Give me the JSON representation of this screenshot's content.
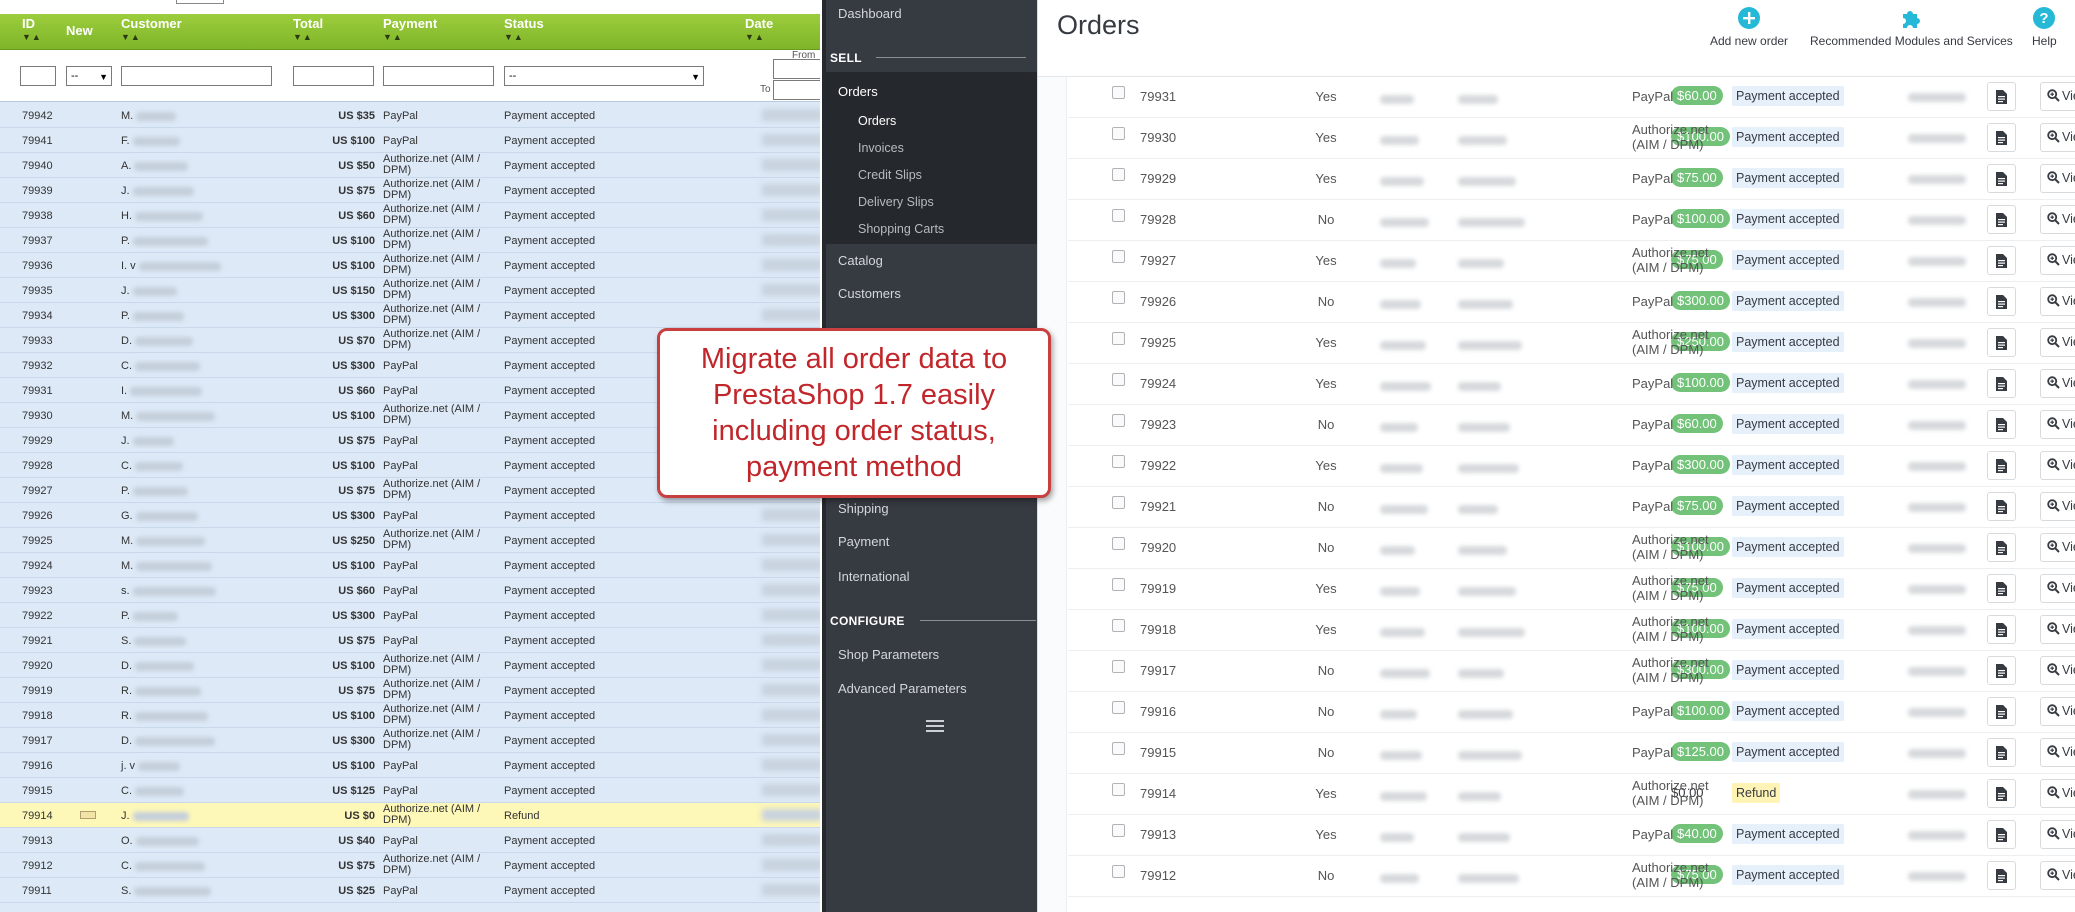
{
  "left": {
    "headers": {
      "id": "ID",
      "new": "New",
      "customer": "Customer",
      "total": "Total",
      "payment": "Payment",
      "status": "Status",
      "date": "Date"
    },
    "filters": {
      "new_value": "--",
      "status_value": "--",
      "from_label": "From",
      "to_label": "To"
    },
    "rows": [
      {
        "id": "79942",
        "initial": "M.",
        "total": "US $35",
        "payment": "PayPal",
        "status": "Payment accepted"
      },
      {
        "id": "79941",
        "initial": "F.",
        "total": "US $100",
        "payment": "PayPal",
        "status": "Payment accepted"
      },
      {
        "id": "79940",
        "initial": "A.",
        "total": "US $50",
        "payment": "Authorize.net (AIM / DPM)",
        "status": "Payment accepted"
      },
      {
        "id": "79939",
        "initial": "J.",
        "total": "US $75",
        "payment": "Authorize.net (AIM / DPM)",
        "status": "Payment accepted"
      },
      {
        "id": "79938",
        "initial": "H.",
        "total": "US $60",
        "payment": "Authorize.net (AIM / DPM)",
        "status": "Payment accepted"
      },
      {
        "id": "79937",
        "initial": "P.",
        "total": "US $100",
        "payment": "Authorize.net (AIM / DPM)",
        "status": "Payment accepted"
      },
      {
        "id": "79936",
        "initial": "I. v",
        "total": "US $100",
        "payment": "Authorize.net (AIM / DPM)",
        "status": "Payment accepted"
      },
      {
        "id": "79935",
        "initial": "J.",
        "total": "US $150",
        "payment": "Authorize.net (AIM / DPM)",
        "status": "Payment accepted"
      },
      {
        "id": "79934",
        "initial": "P.",
        "total": "US $300",
        "payment": "Authorize.net (AIM / DPM)",
        "status": "Payment accepted"
      },
      {
        "id": "79933",
        "initial": "D.",
        "total": "US $70",
        "payment": "Authorize.net (AIM / DPM)",
        "status": "Payment accepted"
      },
      {
        "id": "79932",
        "initial": "C.",
        "total": "US $300",
        "payment": "PayPal",
        "status": "Payment accepted"
      },
      {
        "id": "79931",
        "initial": "I.",
        "total": "US $60",
        "payment": "PayPal",
        "status": "Payment accepted"
      },
      {
        "id": "79930",
        "initial": "M.",
        "total": "US $100",
        "payment": "Authorize.net (AIM / DPM)",
        "status": "Payment accepted"
      },
      {
        "id": "79929",
        "initial": "J.",
        "total": "US $75",
        "payment": "PayPal",
        "status": "Payment accepted"
      },
      {
        "id": "79928",
        "initial": "C.",
        "total": "US $100",
        "payment": "PayPal",
        "status": "Payment accepted"
      },
      {
        "id": "79927",
        "initial": "P.",
        "total": "US $75",
        "payment": "Authorize.net (AIM / DPM)",
        "status": "Payment accepted"
      },
      {
        "id": "79926",
        "initial": "G.",
        "total": "US $300",
        "payment": "PayPal",
        "status": "Payment accepted"
      },
      {
        "id": "79925",
        "initial": "M.",
        "total": "US $250",
        "payment": "Authorize.net (AIM / DPM)",
        "status": "Payment accepted"
      },
      {
        "id": "79924",
        "initial": "M.",
        "total": "US $100",
        "payment": "PayPal",
        "status": "Payment accepted"
      },
      {
        "id": "79923",
        "initial": "s.",
        "total": "US $60",
        "payment": "PayPal",
        "status": "Payment accepted"
      },
      {
        "id": "79922",
        "initial": "P.",
        "total": "US $300",
        "payment": "PayPal",
        "status": "Payment accepted"
      },
      {
        "id": "79921",
        "initial": "S.",
        "total": "US $75",
        "payment": "PayPal",
        "status": "Payment accepted"
      },
      {
        "id": "79920",
        "initial": "D.",
        "total": "US $100",
        "payment": "Authorize.net (AIM / DPM)",
        "status": "Payment accepted"
      },
      {
        "id": "79919",
        "initial": "R.",
        "total": "US $75",
        "payment": "Authorize.net (AIM / DPM)",
        "status": "Payment accepted"
      },
      {
        "id": "79918",
        "initial": "R.",
        "total": "US $100",
        "payment": "Authorize.net (AIM / DPM)",
        "status": "Payment accepted"
      },
      {
        "id": "79917",
        "initial": "D.",
        "total": "US $300",
        "payment": "Authorize.net (AIM / DPM)",
        "status": "Payment accepted"
      },
      {
        "id": "79916",
        "initial": "j. v",
        "total": "US $100",
        "payment": "PayPal",
        "status": "Payment accepted"
      },
      {
        "id": "79915",
        "initial": "C.",
        "total": "US $125",
        "payment": "PayPal",
        "status": "Payment accepted"
      },
      {
        "id": "79914",
        "initial": "J.",
        "total": "US $0",
        "payment": "Authorize.net (AIM / DPM)",
        "status": "Refund",
        "highlight": true,
        "has_new_icon": true
      },
      {
        "id": "79913",
        "initial": "O.",
        "total": "US $40",
        "payment": "PayPal",
        "status": "Payment accepted"
      },
      {
        "id": "79912",
        "initial": "C.",
        "total": "US $75",
        "payment": "Authorize.net (AIM / DPM)",
        "status": "Payment accepted"
      },
      {
        "id": "79911",
        "initial": "S.",
        "total": "US $25",
        "payment": "PayPal",
        "status": "Payment accepted"
      }
    ]
  },
  "sidebar": {
    "dashboard": "Dashboard",
    "sell_heading": "SELL",
    "orders": "Orders",
    "sub_items": [
      "Orders",
      "Invoices",
      "Credit Slips",
      "Delivery Slips",
      "Shopping Carts"
    ],
    "catalog": "Catalog",
    "customers": "Customers",
    "shipping": "Shipping",
    "payment": "Payment",
    "international": "International",
    "configure_heading": "CONFIGURE",
    "shop_parameters": "Shop Parameters",
    "advanced_parameters": "Advanced Parameters"
  },
  "right": {
    "title": "Orders",
    "toolbar": {
      "add_new_order": "Add new order",
      "recommended": "Recommended Modules and Services",
      "help": "Help"
    },
    "view_label": "View",
    "accent_color": "#72c279",
    "rows": [
      {
        "id": "79931",
        "new": "Yes",
        "total": "$60.00",
        "payment": "PayPal",
        "status": "Payment accepted"
      },
      {
        "id": "79930",
        "new": "Yes",
        "total": "$100.00",
        "payment": "Authorize.net (AIM / DPM)",
        "status": "Payment accepted"
      },
      {
        "id": "79929",
        "new": "Yes",
        "total": "$75.00",
        "payment": "PayPal",
        "status": "Payment accepted"
      },
      {
        "id": "79928",
        "new": "No",
        "total": "$100.00",
        "payment": "PayPal",
        "status": "Payment accepted"
      },
      {
        "id": "79927",
        "new": "Yes",
        "total": "$75.00",
        "payment": "Authorize.net (AIM / DPM)",
        "status": "Payment accepted"
      },
      {
        "id": "79926",
        "new": "No",
        "total": "$300.00",
        "payment": "PayPal",
        "status": "Payment accepted"
      },
      {
        "id": "79925",
        "new": "Yes",
        "total": "$250.00",
        "payment": "Authorize.net (AIM / DPM)",
        "status": "Payment accepted"
      },
      {
        "id": "79924",
        "new": "Yes",
        "total": "$100.00",
        "payment": "PayPal",
        "status": "Payment accepted"
      },
      {
        "id": "79923",
        "new": "No",
        "total": "$60.00",
        "payment": "PayPal",
        "status": "Payment accepted"
      },
      {
        "id": "79922",
        "new": "Yes",
        "total": "$300.00",
        "payment": "PayPal",
        "status": "Payment accepted"
      },
      {
        "id": "79921",
        "new": "No",
        "total": "$75.00",
        "payment": "PayPal",
        "status": "Payment accepted"
      },
      {
        "id": "79920",
        "new": "No",
        "total": "$100.00",
        "payment": "Authorize.net (AIM / DPM)",
        "status": "Payment accepted"
      },
      {
        "id": "79919",
        "new": "Yes",
        "total": "$75.00",
        "payment": "Authorize.net (AIM / DPM)",
        "status": "Payment accepted"
      },
      {
        "id": "79918",
        "new": "Yes",
        "total": "$100.00",
        "payment": "Authorize.net (AIM / DPM)",
        "status": "Payment accepted"
      },
      {
        "id": "79917",
        "new": "No",
        "total": "$300.00",
        "payment": "Authorize.net (AIM / DPM)",
        "status": "Payment accepted"
      },
      {
        "id": "79916",
        "new": "No",
        "total": "$100.00",
        "payment": "PayPal",
        "status": "Payment accepted"
      },
      {
        "id": "79915",
        "new": "No",
        "total": "$125.00",
        "payment": "PayPal",
        "status": "Payment accepted"
      },
      {
        "id": "79914",
        "new": "Yes",
        "total": "$0.00",
        "payment": "Authorize.net (AIM / DPM)",
        "status": "Refund",
        "plain_total": true
      },
      {
        "id": "79913",
        "new": "Yes",
        "total": "$40.00",
        "payment": "PayPal",
        "status": "Payment accepted"
      },
      {
        "id": "79912",
        "new": "No",
        "total": "$75.00",
        "payment": "Authorize.net (AIM / DPM)",
        "status": "Payment accepted"
      }
    ]
  },
  "callout": {
    "text": "Migrate all order data to PrestaShop 1.7 easily including order status, payment method"
  }
}
